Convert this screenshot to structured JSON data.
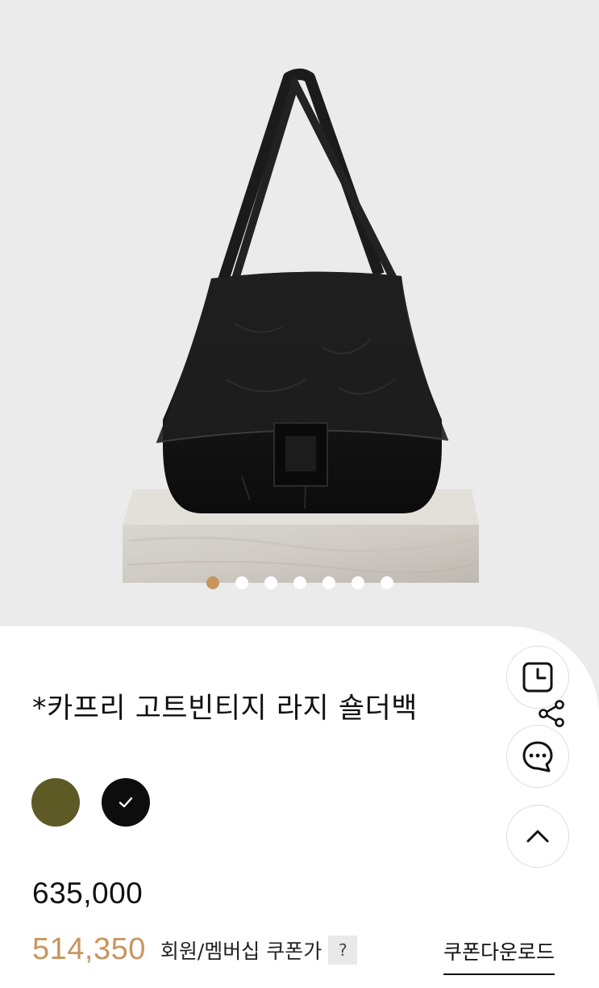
{
  "product": {
    "title": "*카프리 고트빈티지 라지 숄더백",
    "price": "635,000",
    "sale_price": "514,350",
    "sale_label": "회원/멤버십 쿠폰가",
    "help_label": "?",
    "coupon_download": "쿠폰다운로드"
  },
  "gallery": {
    "image_count": 7,
    "active_index": 0,
    "active_dot_color": "#c8955f"
  },
  "colors": [
    {
      "name": "olive",
      "hex": "#5e5a26",
      "selected": false
    },
    {
      "name": "black",
      "hex": "#0d0d0d",
      "selected": true
    }
  ],
  "floating_buttons": [
    "recent-view-icon",
    "share-icon",
    "chat-icon",
    "scroll-top-icon"
  ]
}
